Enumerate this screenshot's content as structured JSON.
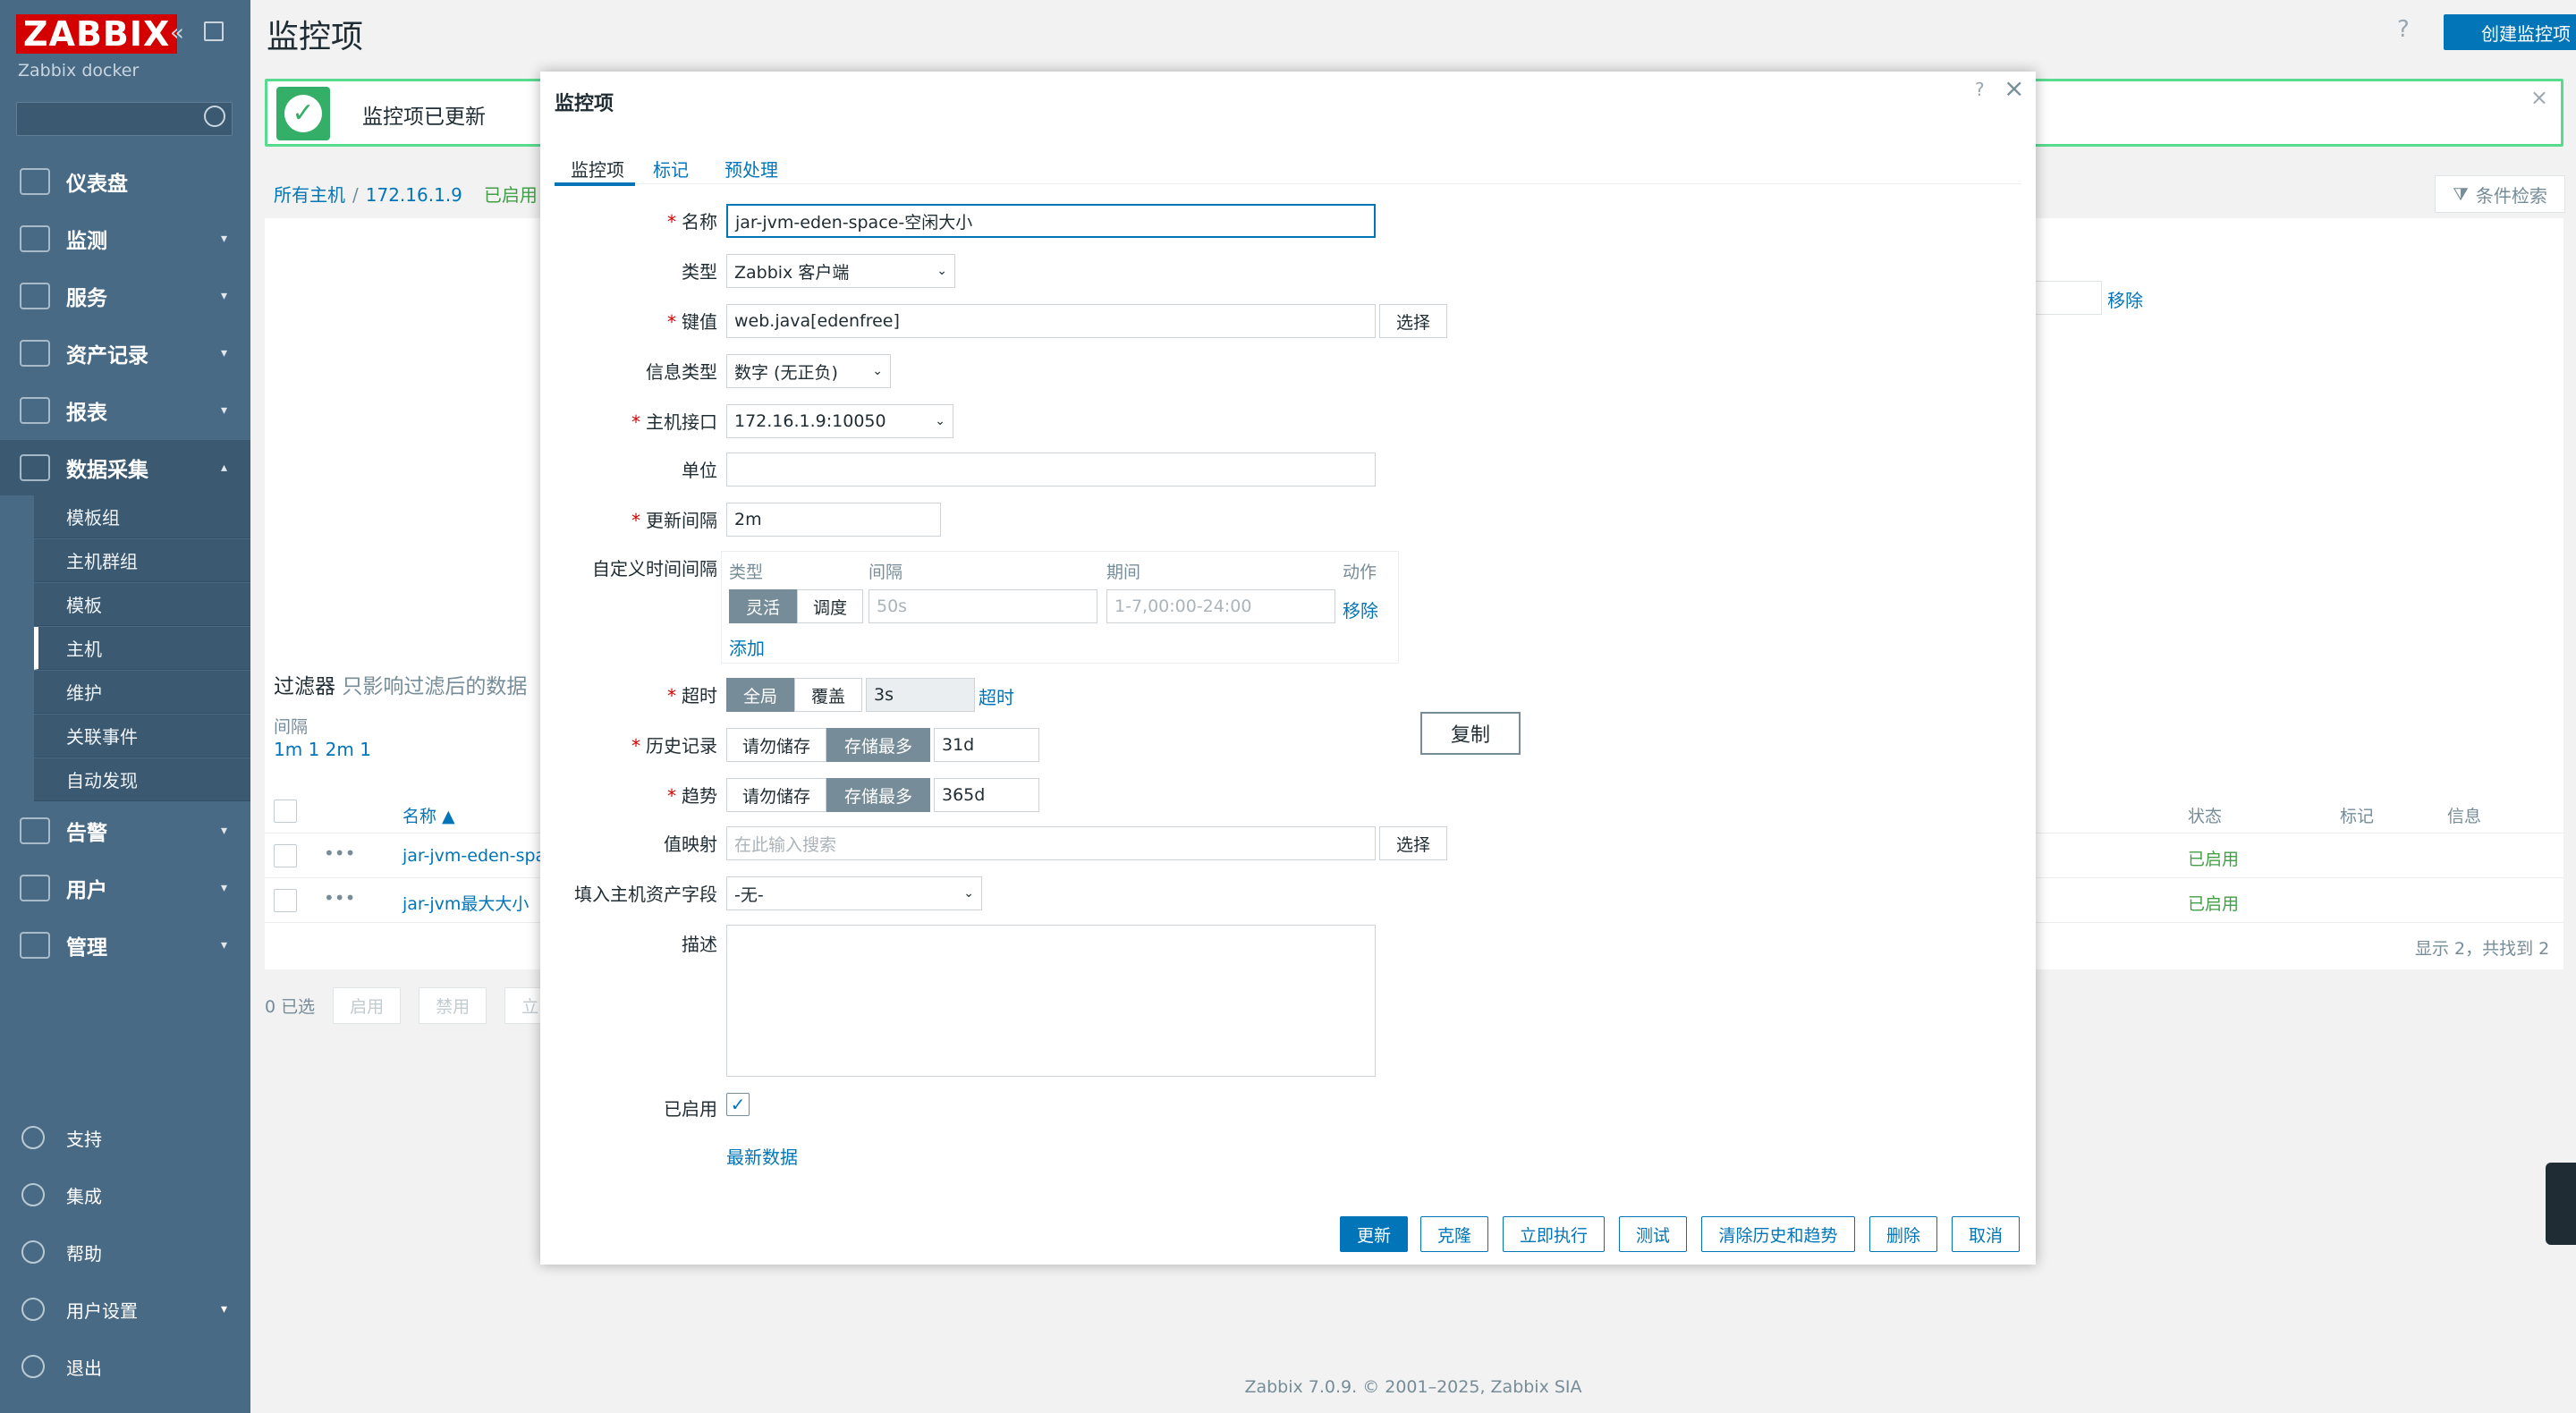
{
  "sidebar": {
    "logo": "ZABBIX",
    "subtitle": "Zabbix docker",
    "search_placeholder": "",
    "items": [
      {
        "label": "仪表盘"
      },
      {
        "label": "监测"
      },
      {
        "label": "服务"
      },
      {
        "label": "资产记录"
      },
      {
        "label": "报表"
      },
      {
        "label": "数据采集"
      },
      {
        "label": "告警"
      },
      {
        "label": "用户"
      },
      {
        "label": "管理"
      }
    ],
    "sub_items": [
      "模板组",
      "主机群组",
      "模板",
      "主机",
      "维护",
      "关联事件",
      "自动发现"
    ],
    "bottom": [
      {
        "label": "支持"
      },
      {
        "label": "集成"
      },
      {
        "label": "帮助"
      },
      {
        "label": "用户设置"
      },
      {
        "label": "退出"
      }
    ]
  },
  "header": {
    "title": "监控项",
    "help": "?",
    "create_label": "创建监控项"
  },
  "message": {
    "text": "监控项已更新",
    "close": "×"
  },
  "breadcrumb": {
    "all_hosts": "所有主机",
    "sep": "/",
    "host": "172.16.1.9",
    "enabled": "已启用"
  },
  "filter": {
    "button": "条件检索",
    "title": "过滤器",
    "hint": "只影响过滤后的数据",
    "interval_label": "间隔",
    "interval_values": "1m 1   2m 1",
    "remove": "移除"
  },
  "table": {
    "headers": {
      "name": "名称 ▲",
      "status": "状态",
      "tags": "标记",
      "info": "信息"
    },
    "rows": [
      {
        "name": "jar-jvm-eden-spac",
        "status": "已启用"
      },
      {
        "name": "jar-jvm最大大小",
        "status": "已启用"
      }
    ],
    "footer": "显示 2，共找到 2",
    "selected": "0 已选",
    "actions": [
      "启用",
      "禁用",
      "立"
    ]
  },
  "modal": {
    "title": "监控项",
    "help": "?",
    "close": "×",
    "tabs": [
      "监控项",
      "标记",
      "预处理"
    ],
    "fields": {
      "name_label": "名称",
      "name_value": "jar-jvm-eden-space-空闲大小",
      "type_label": "类型",
      "type_value": "Zabbix 客户端",
      "key_label": "键值",
      "key_value": "web.java[edenfree]",
      "select_label": "选择",
      "info_type_label": "信息类型",
      "info_type_value": "数字 (无正负)",
      "interface_label": "主机接口",
      "interface_value": "172.16.1.9:10050",
      "unit_label": "单位",
      "unit_value": "",
      "interval_label": "更新间隔",
      "interval_value": "2m",
      "custom_label": "自定义时间间隔",
      "custom_headers": [
        "类型",
        "间隔",
        "期间",
        "动作"
      ],
      "custom_flex": "灵活",
      "custom_sched": "调度",
      "custom_interval_ph": "50s",
      "custom_period_ph": "1-7,00:00-24:00",
      "custom_remove": "移除",
      "custom_add": "添加",
      "timeout_label": "超时",
      "timeout_global": "全局",
      "timeout_override": "覆盖",
      "timeout_value": "3s",
      "timeout_link": "超时",
      "history_label": "历史记录",
      "no_store": "请勿储存",
      "store_max": "存储最多",
      "history_value": "31d",
      "trend_label": "趋势",
      "trend_value": "365d",
      "valuemap_label": "值映射",
      "valuemap_ph": "在此输入搜索",
      "inventory_label": "填入主机资产字段",
      "inventory_value": "-无-",
      "desc_label": "描述",
      "enabled_label": "已启用",
      "latest_data": "最新数据",
      "copy": "复制"
    },
    "buttons": [
      "更新",
      "克隆",
      "立即执行",
      "测试",
      "清除历史和趋势",
      "删除",
      "取消"
    ]
  },
  "footer": "Zabbix 7.0.9. © 2001–2025, Zabbix SIA"
}
